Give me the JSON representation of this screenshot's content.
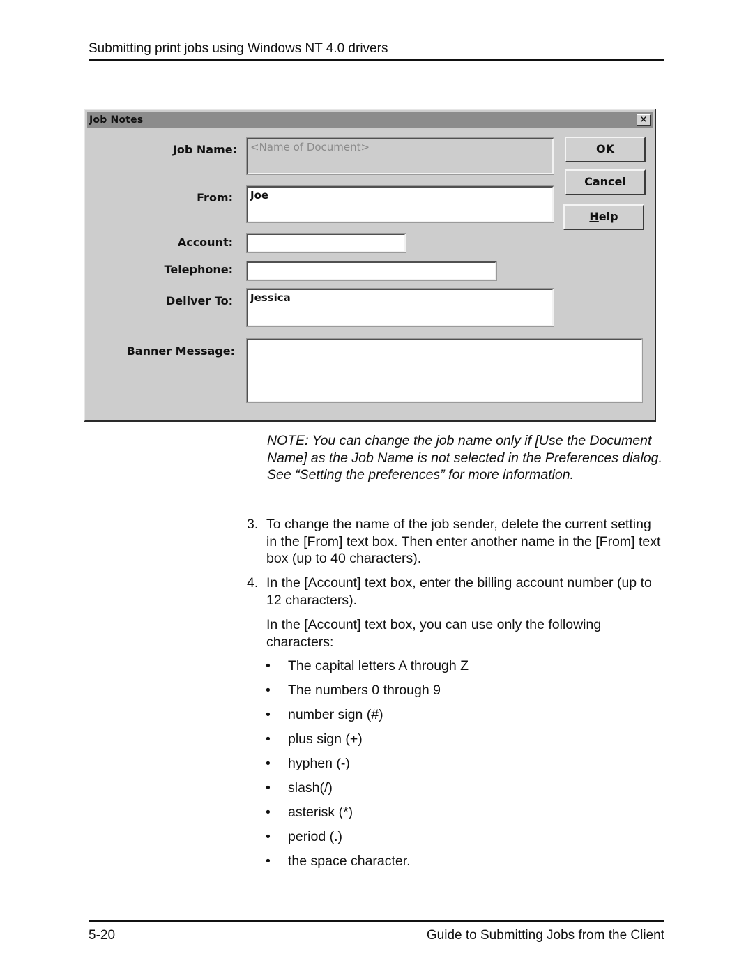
{
  "header": {
    "running_title": "Submitting print jobs using Windows NT 4.0 drivers"
  },
  "dialog": {
    "title": "Job Notes",
    "close_icon": "close-icon",
    "fields": {
      "job_name": {
        "label": "Job Name:",
        "placeholder": "<Name of Document>",
        "value": ""
      },
      "from": {
        "label": "From:",
        "value": "Joe"
      },
      "account": {
        "label": "Account:",
        "value": ""
      },
      "telephone": {
        "label": "Telephone:",
        "value": ""
      },
      "deliver_to": {
        "label": "Deliver To:",
        "value": "Jessica"
      },
      "banner_message": {
        "label": "Banner Message:",
        "value": ""
      }
    },
    "buttons": {
      "ok": "OK",
      "cancel": "Cancel",
      "help_mnemonic": "H",
      "help_rest": "elp"
    }
  },
  "note": "NOTE:  You can change the job name only if [Use the Document Name] as the Job Name is not selected in the Preferences dialog. See “Setting the preferences” for more information.",
  "steps": [
    {
      "num": "3.",
      "text": "To change the name of the job sender, delete the current setting in the [From] text box. Then enter another name in the [From] text box (up to 40 characters)."
    },
    {
      "num": "4.",
      "text": "In the [Account] text box, enter the billing account number (up to 12 characters)."
    }
  ],
  "account_para": "In the [Account] text box, you can use only the following characters:",
  "bullet_glyph": "•",
  "allowed_chars": [
    "The capital letters A through Z",
    "The numbers 0 through 9",
    "number sign (#)",
    "plus sign (+)",
    "hyphen (-)",
    "slash(/)",
    "asterisk (*)",
    "period (.)",
    "the space character."
  ],
  "footer": {
    "page_number": "5-20",
    "book_title": "Guide to Submitting Jobs from the Client"
  }
}
